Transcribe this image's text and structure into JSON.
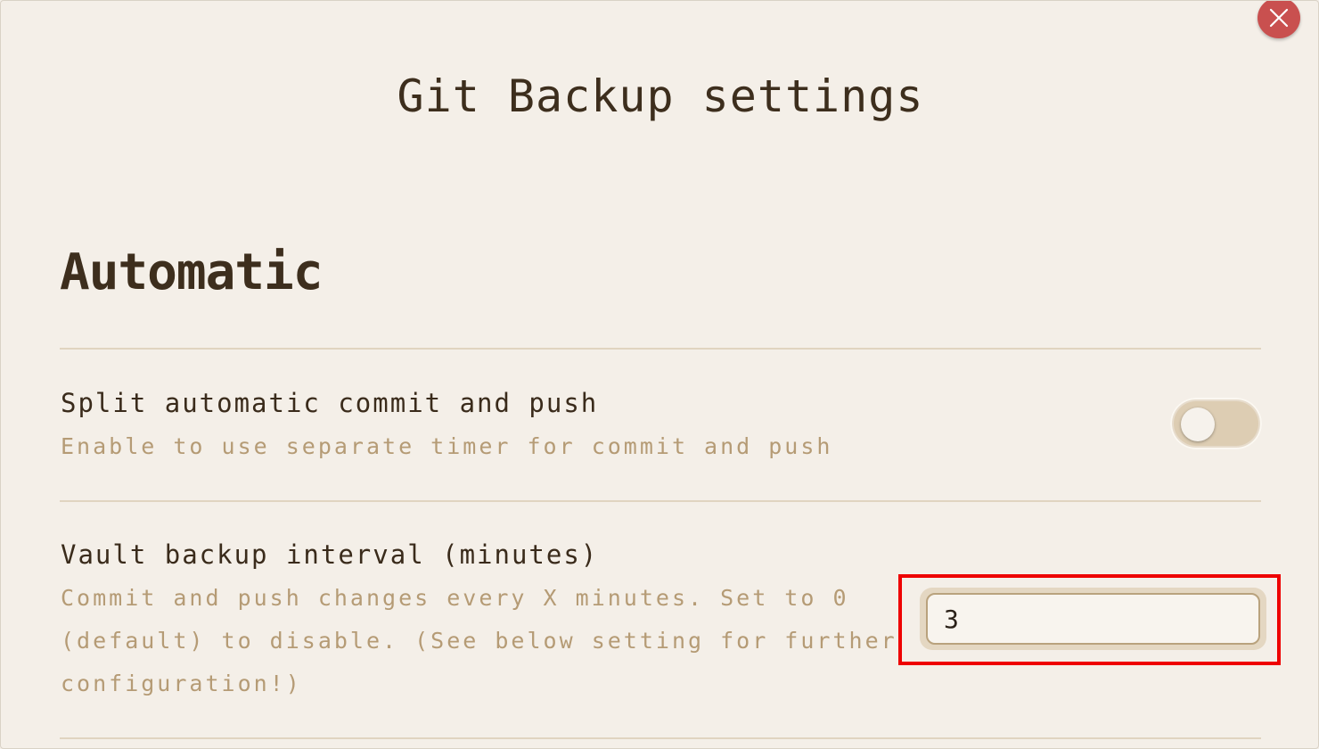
{
  "modal": {
    "title": "Git Backup settings",
    "close_icon": "close-icon"
  },
  "section": {
    "heading": "Automatic"
  },
  "settings": [
    {
      "name": "Split automatic commit and push",
      "description_lines": [
        "Enable to use separate timer for commit and push"
      ],
      "control": "toggle",
      "enabled": false
    },
    {
      "name": "Vault backup interval (minutes)",
      "description_lines": [
        "Commit and push changes every X minutes. Set to 0",
        "(default) to disable. (See below setting for further",
        "configuration!)"
      ],
      "control": "text-input",
      "value": "3"
    }
  ],
  "colors": {
    "highlight": "#ee0000",
    "close_button": "#c9504f",
    "accent_text": "#b59b75"
  }
}
